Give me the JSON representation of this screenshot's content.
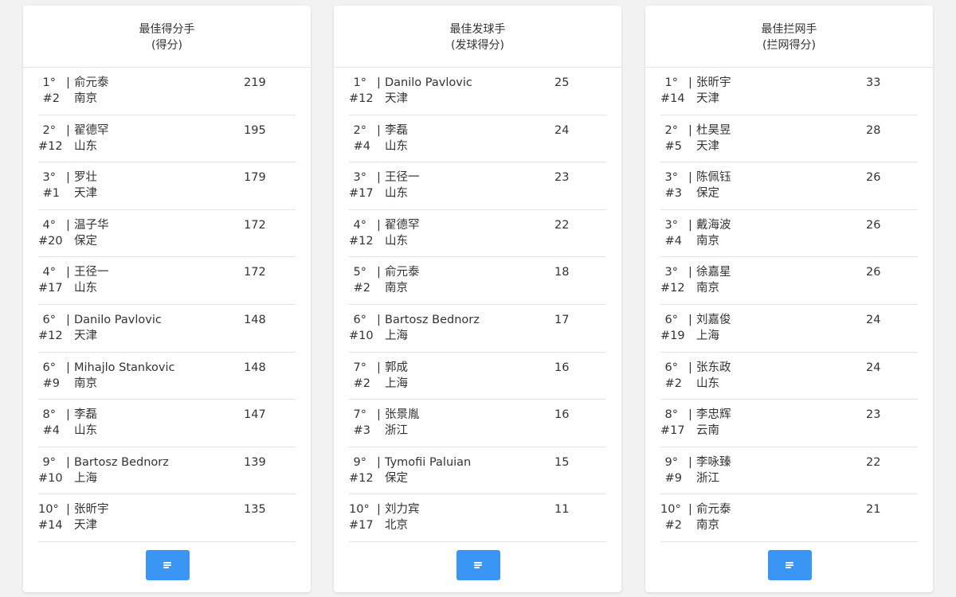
{
  "panels": [
    {
      "title": "最佳得分手",
      "subtitle": "(得分)",
      "rows": [
        {
          "rank": "1°",
          "num": "#2",
          "name": "俞元泰",
          "team": "南京",
          "score": "219"
        },
        {
          "rank": "2°",
          "num": "#12",
          "name": "翟德罕",
          "team": "山东",
          "score": "195"
        },
        {
          "rank": "3°",
          "num": "#1",
          "name": "罗壮",
          "team": "天津",
          "score": "179"
        },
        {
          "rank": "4°",
          "num": "#20",
          "name": "温子华",
          "team": "保定",
          "score": "172"
        },
        {
          "rank": "4°",
          "num": "#17",
          "name": "王径一",
          "team": "山东",
          "score": "172"
        },
        {
          "rank": "6°",
          "num": "#12",
          "name": "Danilo Pavlovic",
          "team": "天津",
          "score": "148"
        },
        {
          "rank": "6°",
          "num": "#9",
          "name": "Mihajlo Stankovic",
          "team": "南京",
          "score": "148"
        },
        {
          "rank": "8°",
          "num": "#4",
          "name": "李磊",
          "team": "山东",
          "score": "147"
        },
        {
          "rank": "9°",
          "num": "#10",
          "name": "Bartosz Bednorz",
          "team": "上海",
          "score": "139"
        },
        {
          "rank": "10°",
          "num": "#14",
          "name": "张昕宇",
          "team": "天津",
          "score": "135"
        }
      ],
      "button_icon": "menu-icon"
    },
    {
      "title": "最佳发球手",
      "subtitle": "(发球得分)",
      "rows": [
        {
          "rank": "1°",
          "num": "#12",
          "name": "Danilo Pavlovic",
          "team": "天津",
          "score": "25"
        },
        {
          "rank": "2°",
          "num": "#4",
          "name": "李磊",
          "team": "山东",
          "score": "24"
        },
        {
          "rank": "3°",
          "num": "#17",
          "name": "王径一",
          "team": "山东",
          "score": "23"
        },
        {
          "rank": "4°",
          "num": "#12",
          "name": "翟德罕",
          "team": "山东",
          "score": "22"
        },
        {
          "rank": "5°",
          "num": "#2",
          "name": "俞元泰",
          "team": "南京",
          "score": "18"
        },
        {
          "rank": "6°",
          "num": "#10",
          "name": "Bartosz Bednorz",
          "team": "上海",
          "score": "17"
        },
        {
          "rank": "7°",
          "num": "#2",
          "name": "郭成",
          "team": "上海",
          "score": "16"
        },
        {
          "rank": "7°",
          "num": "#3",
          "name": "张景胤",
          "team": "浙江",
          "score": "16"
        },
        {
          "rank": "9°",
          "num": "#12",
          "name": "Tymofii Paluian",
          "team": "保定",
          "score": "15"
        },
        {
          "rank": "10°",
          "num": "#17",
          "name": "刘力宾",
          "team": "北京",
          "score": "11"
        }
      ],
      "button_icon": "menu-icon"
    },
    {
      "title": "最佳拦网手",
      "subtitle": "(拦网得分)",
      "rows": [
        {
          "rank": "1°",
          "num": "#14",
          "name": "张昕宇",
          "team": "天津",
          "score": "33"
        },
        {
          "rank": "2°",
          "num": "#5",
          "name": "杜昊昱",
          "team": "天津",
          "score": "28"
        },
        {
          "rank": "3°",
          "num": "#3",
          "name": "陈佩钰",
          "team": "保定",
          "score": "26"
        },
        {
          "rank": "3°",
          "num": "#4",
          "name": "戴海波",
          "team": "南京",
          "score": "26"
        },
        {
          "rank": "3°",
          "num": "#12",
          "name": "徐嘉星",
          "team": "南京",
          "score": "26"
        },
        {
          "rank": "6°",
          "num": "#19",
          "name": "刘嘉俊",
          "team": "上海",
          "score": "24"
        },
        {
          "rank": "6°",
          "num": "#2",
          "name": "张东政",
          "team": "山东",
          "score": "24"
        },
        {
          "rank": "8°",
          "num": "#17",
          "name": "李忠辉",
          "team": "云南",
          "score": "23"
        },
        {
          "rank": "9°",
          "num": "#9",
          "name": "李咏臻",
          "team": "浙江",
          "score": "22"
        },
        {
          "rank": "10°",
          "num": "#2",
          "name": "俞元泰",
          "team": "南京",
          "score": "21"
        }
      ],
      "button_icon": "menu-icon"
    }
  ],
  "colors": {
    "background": "#f2f2f2",
    "card": "#ffffff",
    "text": "#333333",
    "divider": "#e3e3e3",
    "button": "#3a95f5"
  }
}
